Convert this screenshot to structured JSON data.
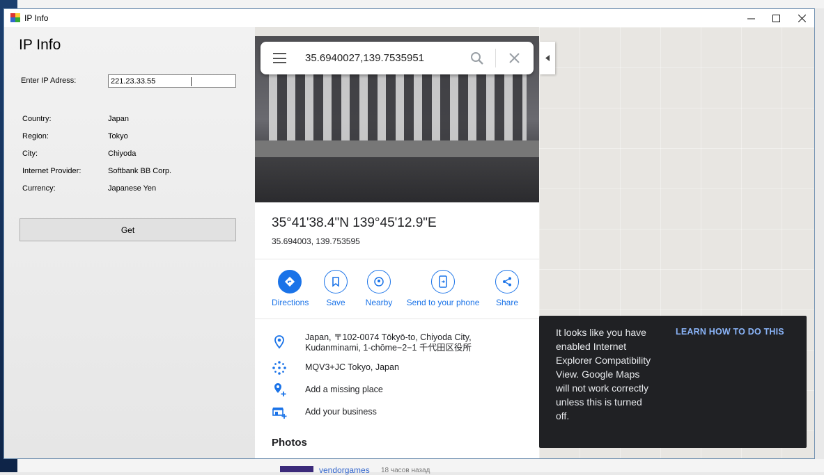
{
  "window": {
    "title": "IP Info"
  },
  "form": {
    "heading": "IP Info",
    "ip_label": "Enter IP Adress:",
    "ip_value": "221.23.33.55",
    "fields": [
      {
        "label": "Country:",
        "value": "Japan"
      },
      {
        "label": "Region:",
        "value": "Tokyo"
      },
      {
        "label": "City:",
        "value": "Chiyoda"
      },
      {
        "label": "Internet Provider:",
        "value": "Softbank BB Corp."
      },
      {
        "label": "Currency:",
        "value": "Japanese Yen"
      }
    ],
    "get_label": "Get"
  },
  "maps": {
    "search_value": "35.6940027,139.7535951",
    "coords_dms": "35°41'38.4\"N 139°45'12.9\"E",
    "coords_decimal": "35.694003, 139.753595",
    "actions": [
      {
        "label": "Directions",
        "icon": "directions-icon"
      },
      {
        "label": "Save",
        "icon": "bookmark-icon"
      },
      {
        "label": "Nearby",
        "icon": "nearby-icon"
      },
      {
        "label": "Send to your phone",
        "icon": "send-to-phone-icon"
      },
      {
        "label": "Share",
        "icon": "share-icon"
      }
    ],
    "address_line1": "Japan, 〒102-0074 Tōkyō-to, Chiyoda City,",
    "address_line2": "Kudanminami, 1-chōme−2−1 千代田区役所",
    "plus_code": "MQV3+JC Tokyo, Japan",
    "add_missing_place": "Add a missing place",
    "add_business": "Add your business",
    "photos_heading": "Photos",
    "toast": {
      "message": "It looks like you have enabled Internet Explorer Compatibility View. Google Maps will not work correctly unless this is turned off.",
      "link": "LEARN HOW TO DO THIS"
    }
  },
  "background": {
    "comment_user": "vendorgames",
    "comment_time": "18 часов назад"
  },
  "colors": {
    "accent": "#1a73e8",
    "toast_bg": "#202124",
    "toast_link": "#8ab4f8"
  }
}
